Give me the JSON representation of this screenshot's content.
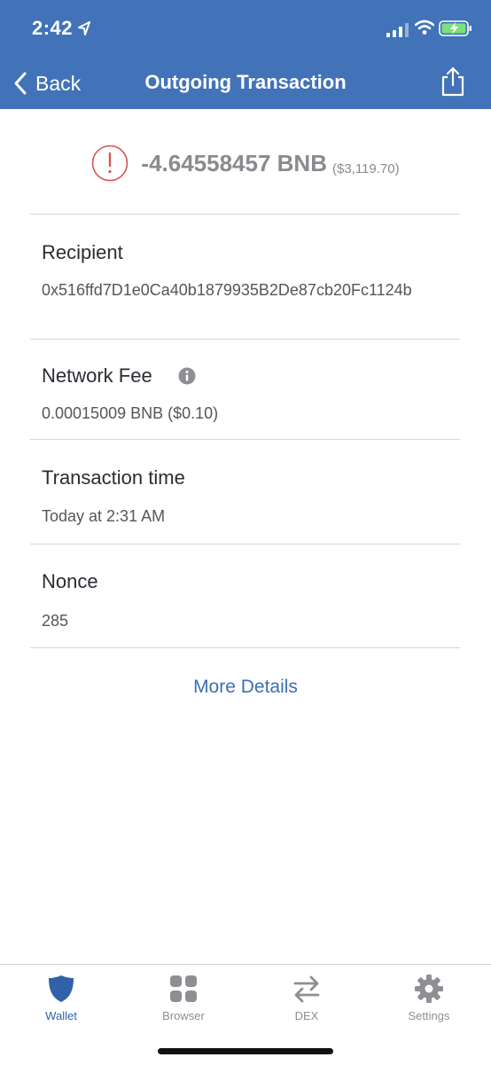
{
  "status_bar": {
    "time": "2:42"
  },
  "nav": {
    "back_label": "Back",
    "title": "Outgoing Transaction"
  },
  "summary": {
    "amount": "-4.64558457 BNB",
    "fiat": "($3,119.70)"
  },
  "details": {
    "recipient_label": "Recipient",
    "recipient_value": "0x516ffd7D1e0Ca40b1879935B2De87cb20Fc1124b",
    "fee_label": "Network Fee",
    "fee_value": "0.00015009 BNB ($0.10)",
    "time_label": "Transaction time",
    "time_value": "Today at 2:31 AM",
    "nonce_label": "Nonce",
    "nonce_value": "285"
  },
  "more_details_label": "More Details",
  "tabs": [
    {
      "label": "Wallet",
      "icon": "shield-icon",
      "active": true
    },
    {
      "label": "Browser",
      "icon": "grid-icon",
      "active": false
    },
    {
      "label": "DEX",
      "icon": "swap-arrows-icon",
      "active": false
    },
    {
      "label": "Settings",
      "icon": "gear-icon",
      "active": false
    }
  ],
  "colors": {
    "header_bg": "#4273b8",
    "accent": "#3a6fb5",
    "alert": "#d9534f",
    "active_tab": "#2f62a8",
    "inactive_tab": "#8e8e93"
  }
}
